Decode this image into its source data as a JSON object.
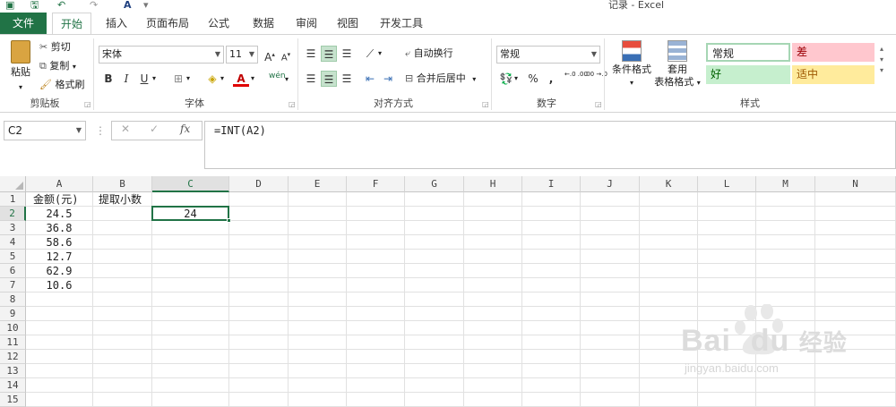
{
  "window": {
    "title": "记录 - Excel"
  },
  "quick_access": {
    "save_icon": "save-icon",
    "undo_icon": "undo-icon",
    "redo_icon": "redo-icon",
    "font_color_icon": "font-color-icon"
  },
  "tabs": [
    {
      "label": "文件"
    },
    {
      "label": "开始"
    },
    {
      "label": "插入"
    },
    {
      "label": "页面布局"
    },
    {
      "label": "公式"
    },
    {
      "label": "数据"
    },
    {
      "label": "审阅"
    },
    {
      "label": "视图"
    },
    {
      "label": "开发工具"
    }
  ],
  "ribbon": {
    "clipboard": {
      "label": "剪贴板",
      "paste": "粘贴",
      "cut": "剪切",
      "copy": "复制",
      "format_painter": "格式刷"
    },
    "font": {
      "label": "字体",
      "font_name": "宋体",
      "font_size": "11",
      "bold": "B",
      "italic": "I",
      "underline": "U",
      "phonetic": "wén"
    },
    "alignment": {
      "label": "对齐方式",
      "wrap_text": "自动换行",
      "merge_center": "合并后居中"
    },
    "number": {
      "label": "数字",
      "format": "常规",
      "percent": "%",
      "comma": ",",
      "inc_decimal": "←.0 .00",
      "dec_decimal": ".00 →.0"
    },
    "styles": {
      "label": "样式",
      "conditional": "条件格式",
      "table_format_1": "套用",
      "table_format_2": "表格格式",
      "normal": "常规",
      "bad": "差",
      "good": "好",
      "neutral": "适中",
      "colors": {
        "bad_bg": "#ffc7ce",
        "good_bg": "#c6efce",
        "neutral_bg": "#ffeb9c"
      }
    }
  },
  "formula_bar": {
    "name_box": "C2",
    "cancel": "✕",
    "enter": "✓",
    "fx": "fx",
    "formula": "=INT(A2)"
  },
  "sheet": {
    "columns": [
      "A",
      "B",
      "C",
      "D",
      "E",
      "F",
      "G",
      "H",
      "I",
      "J",
      "K",
      "L",
      "M",
      "N"
    ],
    "rows": [
      "1",
      "2",
      "3",
      "4",
      "5",
      "6",
      "7",
      "8",
      "9",
      "10",
      "11",
      "12",
      "13",
      "14",
      "15"
    ],
    "selected_cell": "C2",
    "cells": {
      "A1": "金额(元)",
      "B1": "提取小数",
      "A2": "24.5",
      "A3": "36.8",
      "A4": "58.6",
      "A5": "12.7",
      "A6": "62.9",
      "A7": "10.6",
      "C2": "24"
    }
  },
  "watermark": {
    "brand": "Bai",
    "brand2": "du",
    "suffix": "经验",
    "url": "jingyan.baidu.com"
  },
  "accent": "#217346"
}
